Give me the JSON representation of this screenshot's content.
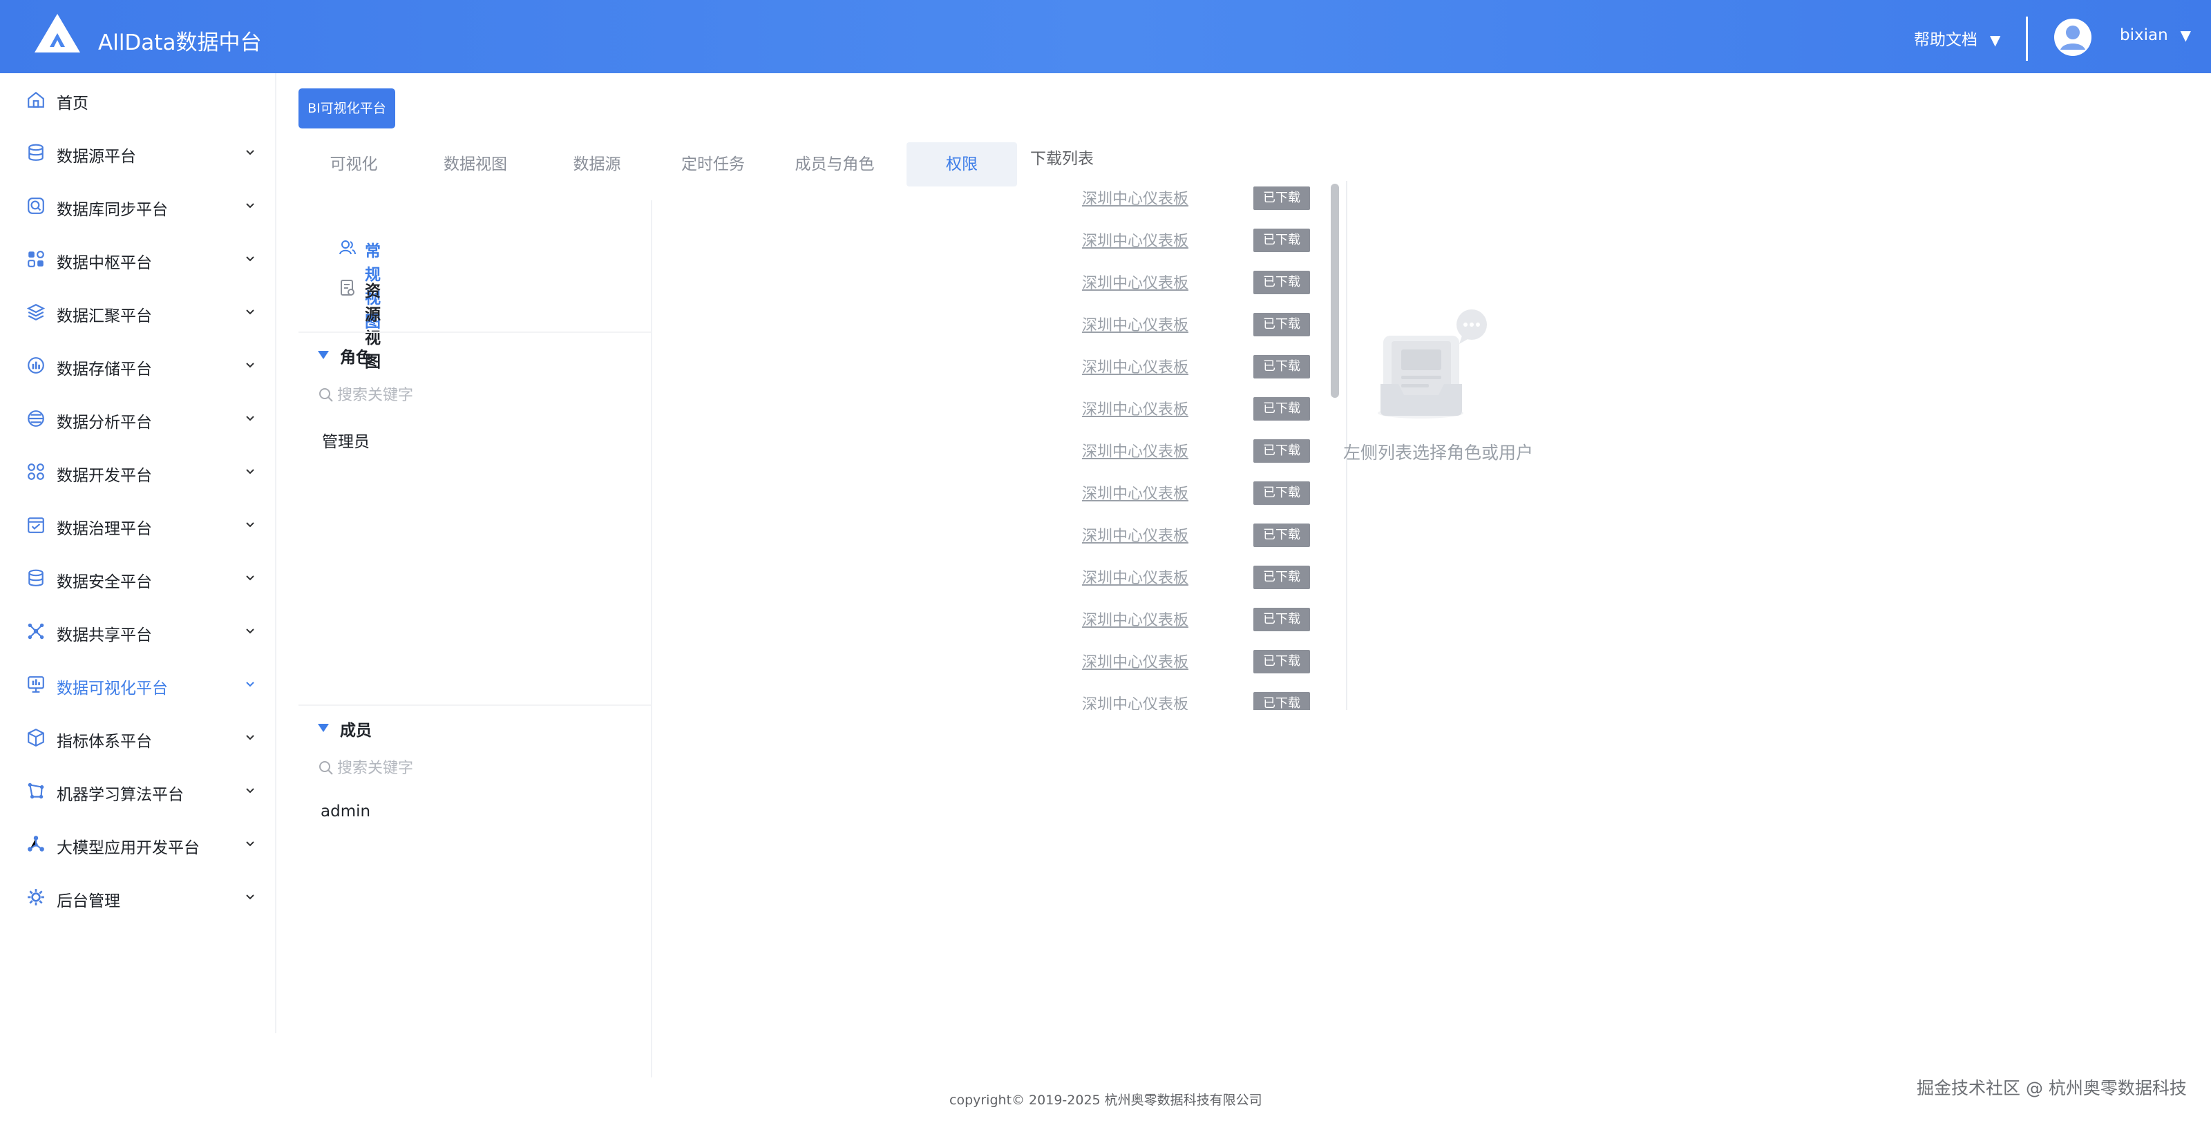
{
  "header": {
    "title": "AllData数据中台",
    "help_label": "帮助文档",
    "user_name": "bixian",
    "accent": "#3f7bea"
  },
  "sidebar": {
    "items": [
      {
        "label": "首页",
        "icon": "home-icon",
        "expandable": false
      },
      {
        "label": "数据源平台",
        "icon": "database-icon",
        "expandable": true
      },
      {
        "label": "数据库同步平台",
        "icon": "sync-icon",
        "expandable": true
      },
      {
        "label": "数据中枢平台",
        "icon": "grid-icon",
        "expandable": true
      },
      {
        "label": "数据汇聚平台",
        "icon": "layers-icon",
        "expandable": true
      },
      {
        "label": "数据存储平台",
        "icon": "storage-icon",
        "expandable": true
      },
      {
        "label": "数据分析平台",
        "icon": "analysis-icon",
        "expandable": true
      },
      {
        "label": "数据开发平台",
        "icon": "develop-icon",
        "expandable": true
      },
      {
        "label": "数据治理平台",
        "icon": "governance-icon",
        "expandable": true
      },
      {
        "label": "数据安全平台",
        "icon": "security-icon",
        "expandable": true
      },
      {
        "label": "数据共享平台",
        "icon": "share-icon",
        "expandable": true
      },
      {
        "label": "数据可视化平台",
        "icon": "visualization-icon",
        "expandable": true,
        "active": true
      },
      {
        "label": "指标体系平台",
        "icon": "cube-icon",
        "expandable": true
      },
      {
        "label": "机器学习算法平台",
        "icon": "ml-icon",
        "expandable": true
      },
      {
        "label": "大模型应用开发平台",
        "icon": "llm-icon",
        "expandable": true
      },
      {
        "label": "后台管理",
        "icon": "gear-icon",
        "expandable": true
      }
    ]
  },
  "main": {
    "bi_button_label": "BI可视化平台",
    "tabs": [
      {
        "label": "可视化"
      },
      {
        "label": "数据视图"
      },
      {
        "label": "数据源"
      },
      {
        "label": "定时任务"
      },
      {
        "label": "成员与角色"
      },
      {
        "label": "权限",
        "active": true
      },
      {
        "label": "下载列表"
      }
    ],
    "views": [
      {
        "label": "常规视图",
        "active": true
      },
      {
        "label": "资源视图"
      }
    ],
    "roles_section": {
      "title": "角色",
      "search_placeholder": "搜索关键字",
      "items": [
        "管理员"
      ]
    },
    "members_section": {
      "title": "成员",
      "search_placeholder": "搜索关键字",
      "items": [
        "admin"
      ]
    },
    "downloads": {
      "item_label": "深圳中心仪表板",
      "status_label": "已下载",
      "count": 13
    },
    "empty_state_text": "左侧列表选择角色或用户"
  },
  "footer": {
    "copyright": "copyright© 2019-2025 杭州奥零数据科技有限公司",
    "watermark": "掘金技术社区 @ 杭州奥零数据科技"
  }
}
